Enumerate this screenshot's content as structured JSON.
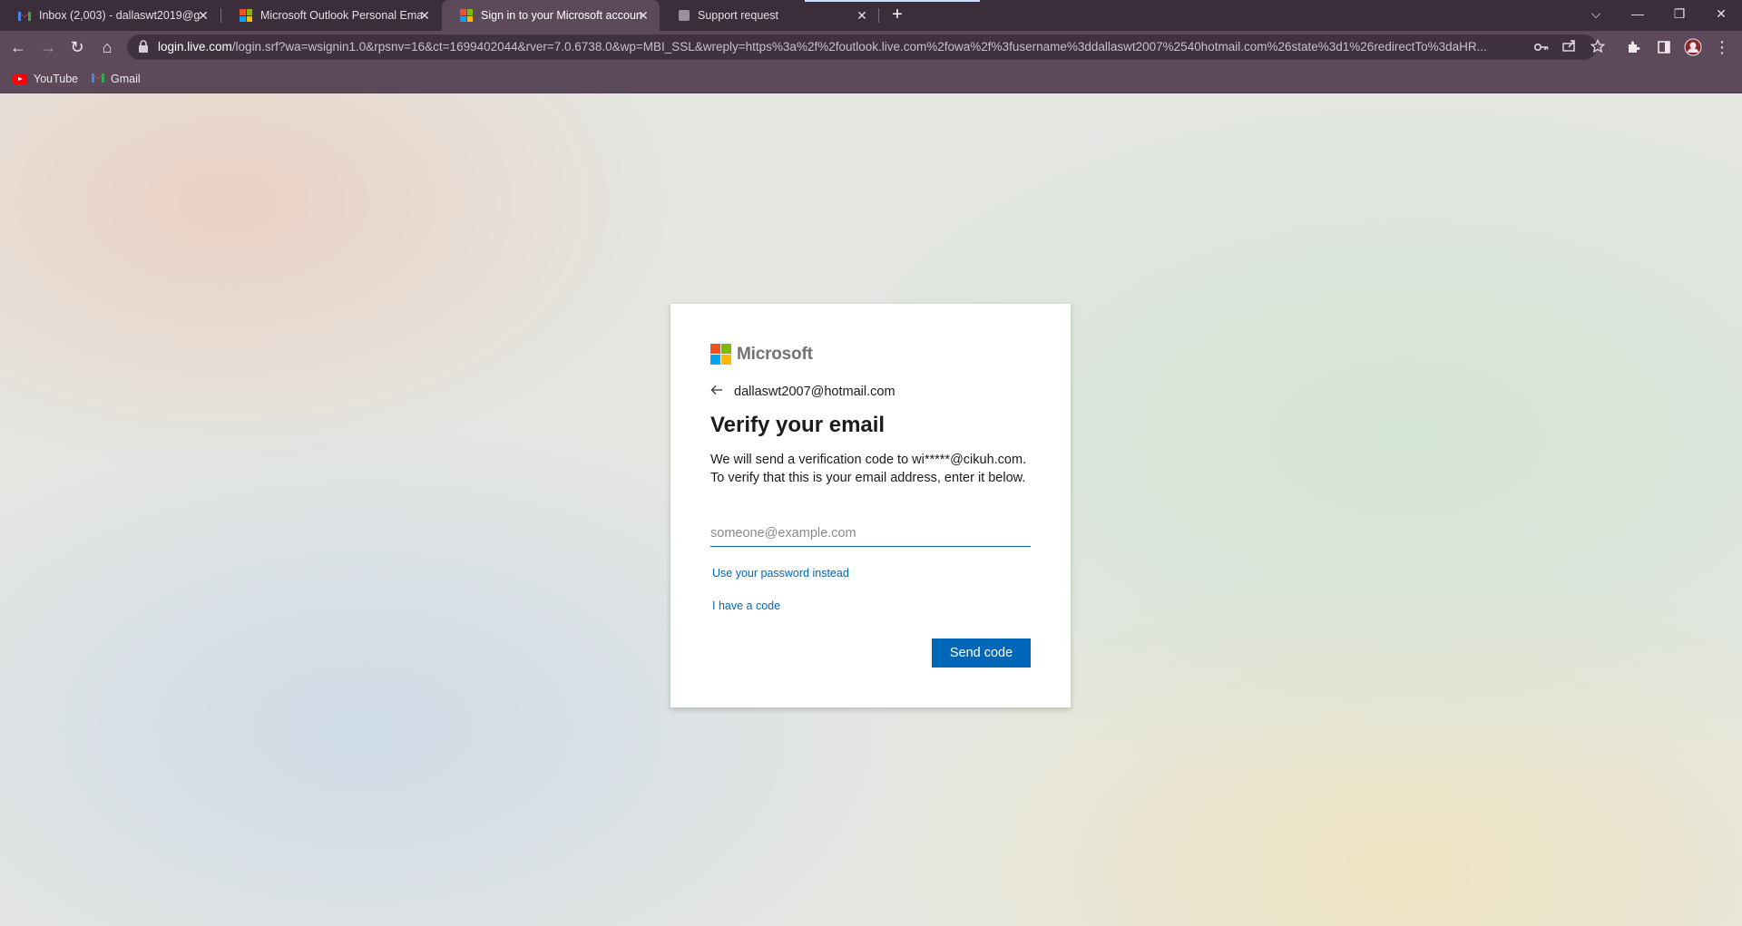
{
  "tabs": [
    {
      "title": "Inbox (2,003) - dallaswt2019@gm",
      "icon": "gmail-icon"
    },
    {
      "title": "Microsoft Outlook Personal Ema",
      "icon": "microsoft-icon"
    },
    {
      "title": "Sign in to your Microsoft accoun",
      "icon": "microsoft-icon",
      "active": true
    },
    {
      "title": "Support request",
      "icon": "document-icon"
    }
  ],
  "tab_close": "✕",
  "new_tab": "+",
  "window_controls": {
    "tab_search": "⌵",
    "minimize": "—",
    "restore": "❐",
    "close": "✕"
  },
  "toolbar": {
    "back": "←",
    "forward": "→",
    "reload": "↻",
    "home": "⌂",
    "url_host": "login.live.com",
    "url_path": "/login.srf?wa=wsignin1.0&rpsnv=16&ct=1699402044&rver=7.0.6738.0&wp=MBI_SSL&wreply=https%3a%2f%2foutlook.live.com%2fowa%2f%3fusername%3ddallaswt2007%2540hotmail.com%26state%3d1%26redirectTo%3daHR..."
  },
  "bookmarks": [
    {
      "label": "YouTube",
      "icon": "youtube-icon"
    },
    {
      "label": "Gmail",
      "icon": "gmail-icon"
    }
  ],
  "card": {
    "brand": "Microsoft",
    "identity": "dallaswt2007@hotmail.com",
    "title": "Verify your email",
    "description": "We will send a verification code to wi*****@cikuh.com. To verify that this is your email address, enter it below.",
    "email_placeholder": "someone@example.com",
    "email_value": "",
    "link_password": "Use your password instead",
    "link_code": "I have a code",
    "send_button": "Send code"
  },
  "colors": {
    "accent": "#0067b8",
    "chrome": "#5c4a5a",
    "tabstrip": "#3b2d3a"
  }
}
